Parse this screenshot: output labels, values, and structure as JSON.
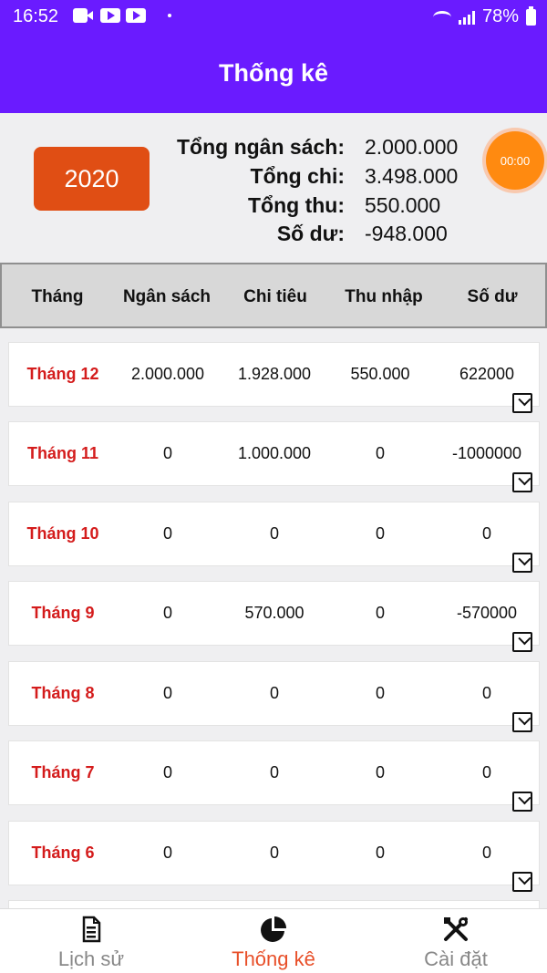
{
  "status_bar": {
    "time": "16:52",
    "battery": "78%"
  },
  "app_bar": {
    "title": "Thống kê"
  },
  "summary": {
    "year": "2020",
    "timer": "00:00",
    "rows": [
      {
        "label": "Tổng ngân sách:",
        "value": "2.000.000"
      },
      {
        "label": "Tổng chi:",
        "value": "3.498.000"
      },
      {
        "label": "Tổng thu:",
        "value": "550.000"
      },
      {
        "label": "Số dư:",
        "value": "-948.000"
      }
    ]
  },
  "table": {
    "headers": [
      "Tháng",
      "Ngân sách",
      "Chi tiêu",
      "Thu nhập",
      "Số dư"
    ],
    "rows": [
      {
        "month": "Tháng 12",
        "budget": "2.000.000",
        "spending": "1.928.000",
        "income": "550.000",
        "balance": "622000"
      },
      {
        "month": "Tháng 11",
        "budget": "0",
        "spending": "1.000.000",
        "income": "0",
        "balance": "-1000000"
      },
      {
        "month": "Tháng 10",
        "budget": "0",
        "spending": "0",
        "income": "0",
        "balance": "0"
      },
      {
        "month": "Tháng 9",
        "budget": "0",
        "spending": "570.000",
        "income": "0",
        "balance": "-570000"
      },
      {
        "month": "Tháng 8",
        "budget": "0",
        "spending": "0",
        "income": "0",
        "balance": "0"
      },
      {
        "month": "Tháng 7",
        "budget": "0",
        "spending": "0",
        "income": "0",
        "balance": "0"
      },
      {
        "month": "Tháng 6",
        "budget": "0",
        "spending": "0",
        "income": "0",
        "balance": "0"
      }
    ]
  },
  "bottom_nav": {
    "items": [
      {
        "label": "Lịch sử",
        "icon": "document-icon"
      },
      {
        "label": "Thống kê",
        "icon": "pie-chart-icon"
      },
      {
        "label": "Cài đặt",
        "icon": "tools-icon"
      }
    ],
    "active_index": 1
  },
  "colors": {
    "primary": "#6a1bff",
    "year_button": "#e04e14",
    "timer": "#ff8a10",
    "month_text": "#d41c1c",
    "active_tab": "#e8502a"
  }
}
